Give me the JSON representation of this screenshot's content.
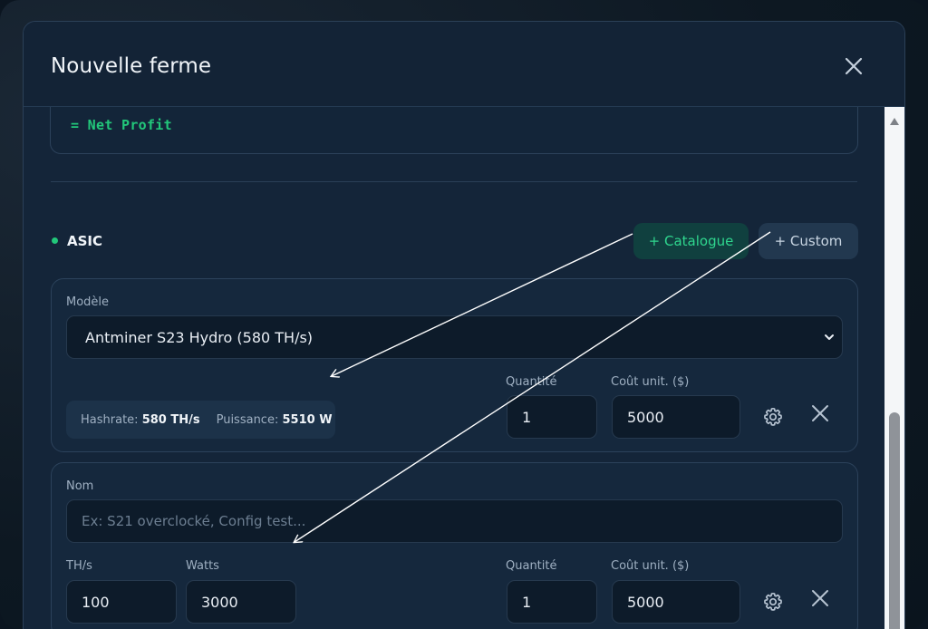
{
  "modal": {
    "title": "Nouvelle ferme"
  },
  "formula": {
    "result_line": "= Net Profit"
  },
  "asic_section": {
    "title": "ASIC",
    "catalogue_button": "+ Catalogue",
    "custom_button": "+ Custom"
  },
  "catalogue_card": {
    "model_label": "Modèle",
    "model_value": "Antminer S23 Hydro (580 TH/s)",
    "hashrate_label": "Hashrate:",
    "hashrate_value": "580 TH/s",
    "power_label": "Puissance:",
    "power_value": "5510 W",
    "quantity_label": "Quantité",
    "quantity_value": "1",
    "unit_cost_label": "Coût unit. ($)",
    "unit_cost_value": "5000"
  },
  "custom_card": {
    "name_label": "Nom",
    "name_placeholder": "Ex: S21 overclocké, Config test...",
    "ths_label": "TH/s",
    "ths_value": "100",
    "watts_label": "Watts",
    "watts_value": "3000",
    "quantity_label": "Quantité",
    "quantity_value": "1",
    "unit_cost_label": "Coût unit. ($)",
    "unit_cost_value": "5000"
  },
  "colors": {
    "accent_green": "#22c77a",
    "modal_bg": "#142539",
    "input_bg": "#0d1b2a"
  },
  "icons": [
    "close-icon",
    "chevron-down-icon",
    "gear-icon",
    "remove-icon",
    "scroll-up-icon"
  ]
}
